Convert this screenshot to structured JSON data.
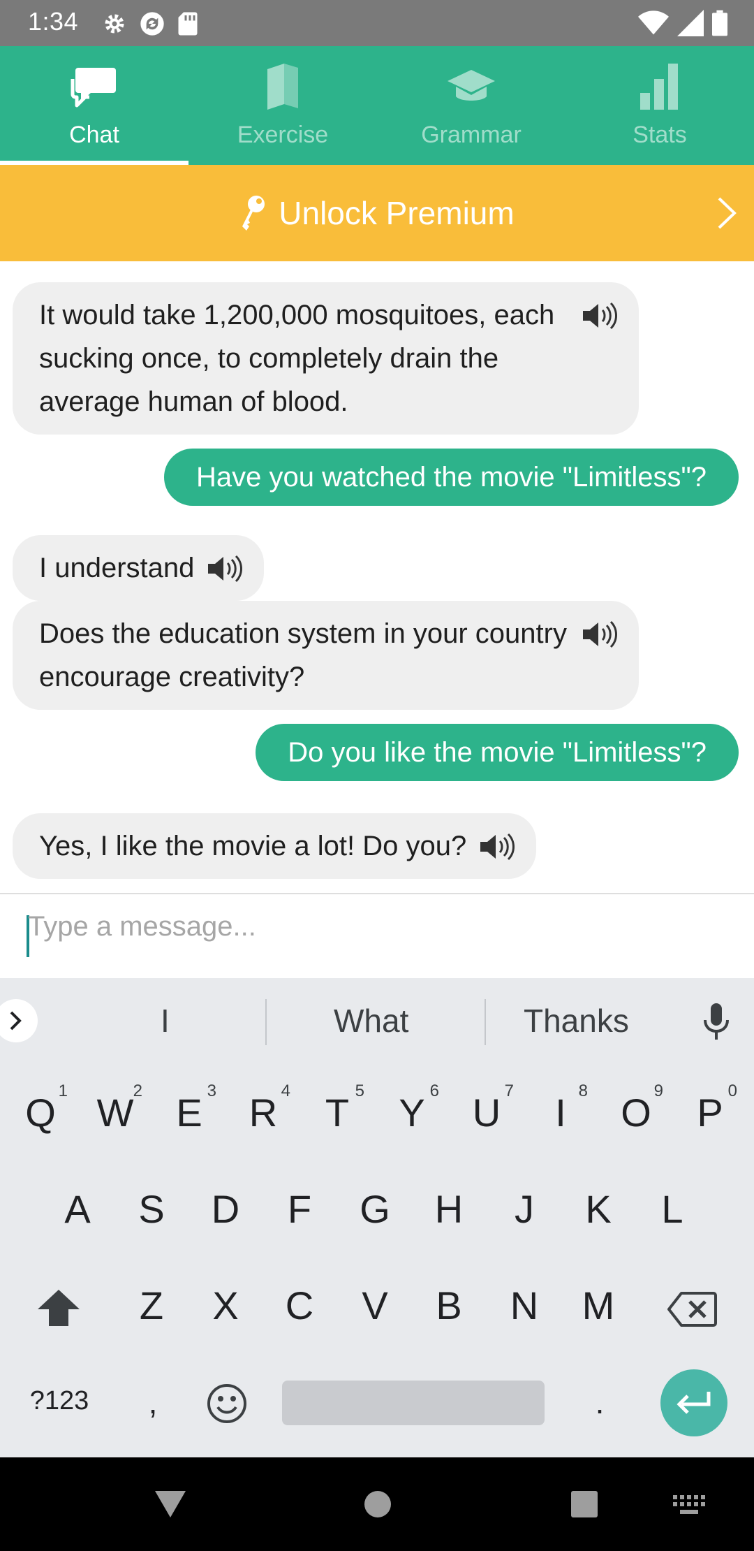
{
  "status_bar": {
    "time": "1:34"
  },
  "tabs": [
    {
      "label": "Chat",
      "icon": "chat-icon",
      "active": true
    },
    {
      "label": "Exercise",
      "icon": "book-icon",
      "active": false
    },
    {
      "label": "Grammar",
      "icon": "graduation-cap-icon",
      "active": false
    },
    {
      "label": "Stats",
      "icon": "bar-chart-icon",
      "active": false
    }
  ],
  "premium": {
    "label": "Unlock Premium",
    "icon": "key-icon"
  },
  "messages": [
    {
      "from": "bot",
      "text": "It would take 1,200,000 mosquitoes, each sucking once, to completely drain the average human of blood."
    },
    {
      "from": "user",
      "text": "Have you watched the movie \"Limitless\"?"
    },
    {
      "from": "bot",
      "text": "I understand"
    },
    {
      "from": "bot",
      "text": "Does the education system in your country encourage creativity?"
    },
    {
      "from": "user",
      "text": "Do you like the movie \"Limitless\"?"
    },
    {
      "from": "bot",
      "text": "Yes, I like the movie a lot! Do you?"
    }
  ],
  "input": {
    "placeholder": "Type a message...",
    "value": ""
  },
  "keyboard": {
    "suggestions": [
      "I",
      "What",
      "Thanks"
    ],
    "row1": [
      "Q",
      "W",
      "E",
      "R",
      "T",
      "Y",
      "U",
      "I",
      "O",
      "P"
    ],
    "row1_hints": [
      "1",
      "2",
      "3",
      "4",
      "5",
      "6",
      "7",
      "8",
      "9",
      "0"
    ],
    "row2": [
      "A",
      "S",
      "D",
      "F",
      "G",
      "H",
      "J",
      "K",
      "L"
    ],
    "row3": [
      "Z",
      "X",
      "C",
      "V",
      "B",
      "N",
      "M"
    ],
    "symbols_label": "?123",
    "comma": ",",
    "period": "."
  },
  "colors": {
    "brand_green": "#2db38b",
    "premium_yellow": "#f9bd3a"
  }
}
